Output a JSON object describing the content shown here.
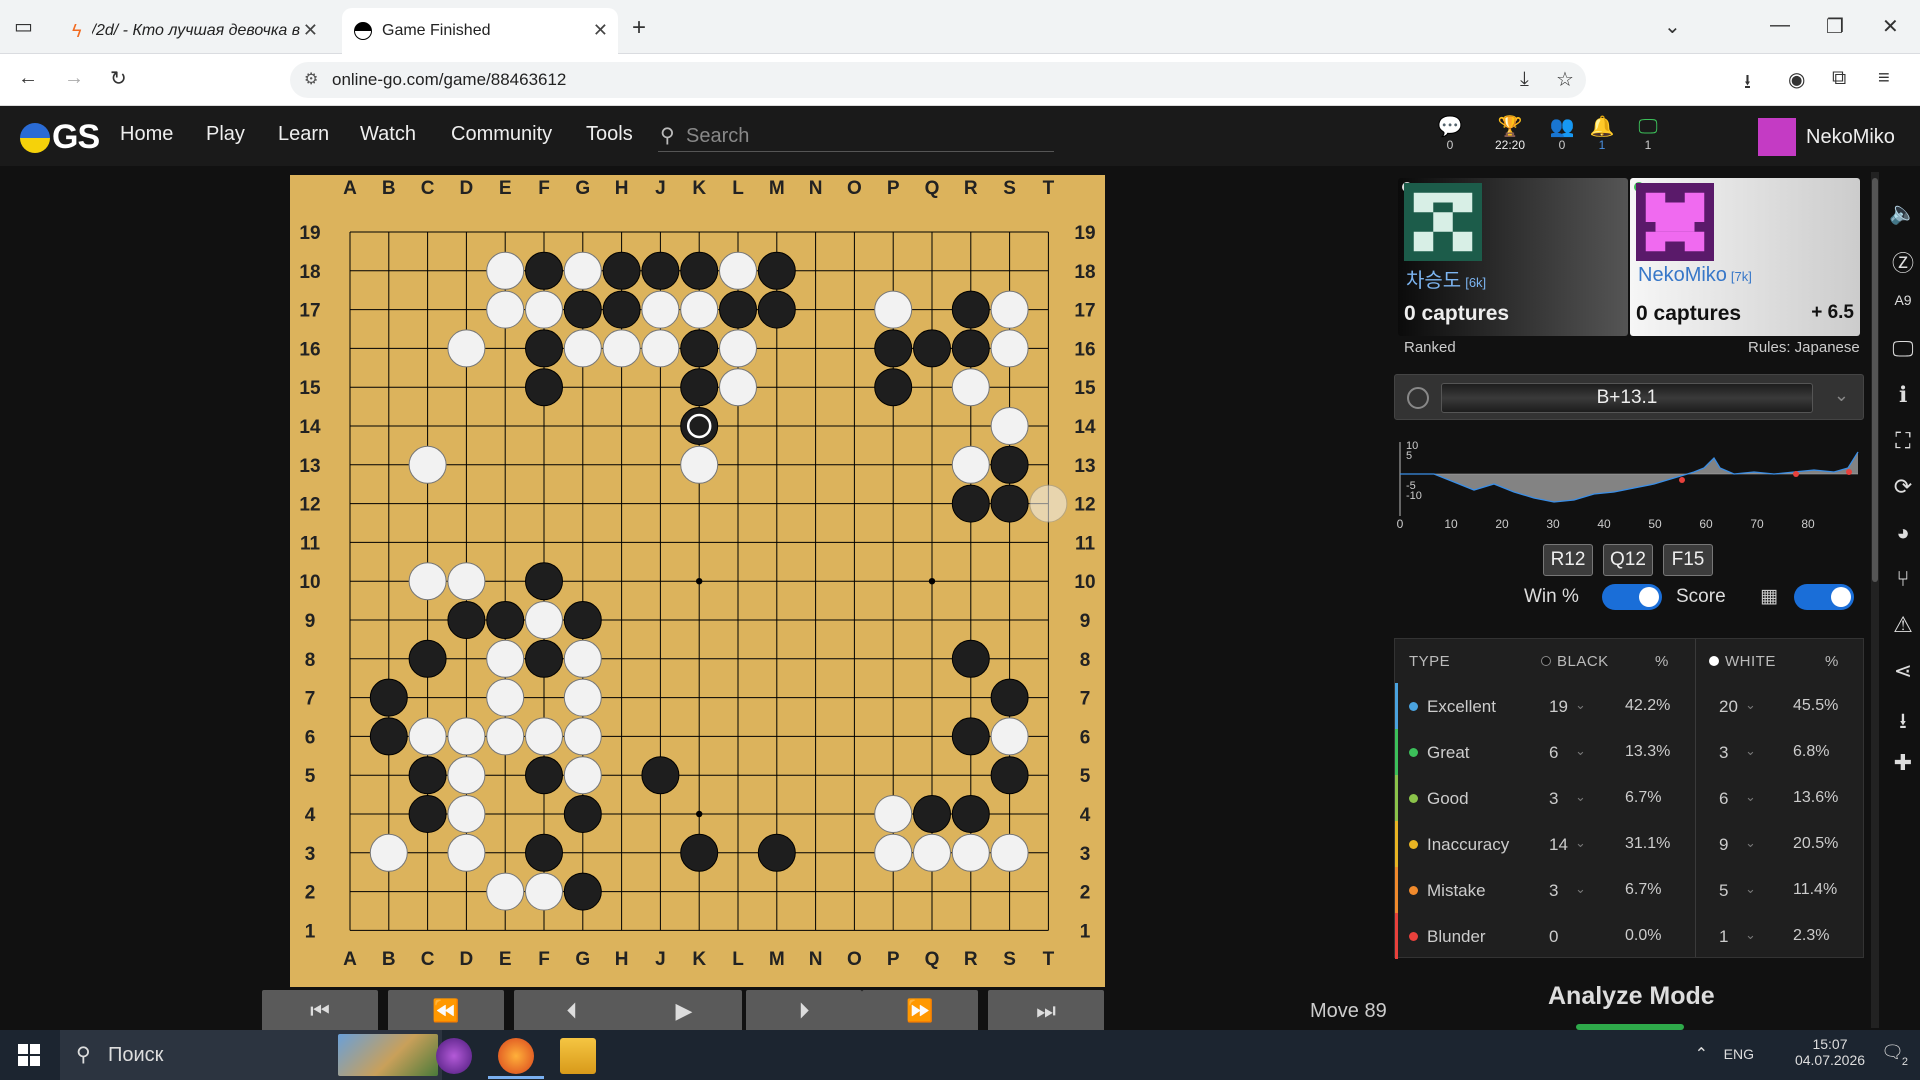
{
  "browser": {
    "tabs": [
      {
        "title": "/2d/ - Кто лучшая девочка в эт"
      },
      {
        "title": "Game Finished"
      }
    ],
    "url": "online-go.com/game/88463612"
  },
  "nav": {
    "logo": "GS",
    "links": [
      "Home",
      "Play",
      "Learn",
      "Watch",
      "Community",
      "Tools"
    ],
    "search_placeholder": "Search",
    "icons": [
      {
        "name": "chat-icon",
        "value": "0"
      },
      {
        "name": "trophy-icon",
        "value": "22:20"
      },
      {
        "name": "friends-icon",
        "value": "0"
      },
      {
        "name": "notifications-icon",
        "value": "1"
      },
      {
        "name": "games-icon",
        "value": "1"
      }
    ],
    "username": "NekoMiko"
  },
  "board": {
    "columns": [
      "A",
      "B",
      "C",
      "D",
      "E",
      "F",
      "G",
      "H",
      "J",
      "K",
      "L",
      "M",
      "N",
      "O",
      "P",
      "Q",
      "R",
      "S",
      "T"
    ],
    "rows": [
      "19",
      "18",
      "17",
      "16",
      "15",
      "14",
      "13",
      "12",
      "11",
      "10",
      "9",
      "8",
      "7",
      "6",
      "5",
      "4",
      "3",
      "2",
      "1"
    ],
    "grid": [
      "...................",
      "....wbwbbbwb.......",
      "....wwbbwwbb..w.bw.",
      "...w.bwwwbw...bbbw.",
      ".....b...bw...b.w..",
      ".........b.......w.",
      "..w......w......wb.",
      "................bb.",
      "...................",
      "..ww.b.............",
      "...bbwb............",
      "..b.wbw.........b..",
      ".b..w.w..........b.",
      ".bwwwww.........bw.",
      "..bw.bw.b........b.",
      "..bw..b.......wbb..",
      ".w.w.b...b.b..wwww.",
      "....wwb............",
      "..................."
    ],
    "last_move": "K14",
    "ghost_move": "T12"
  },
  "controls": {
    "buttons": [
      {
        "name": "first-move-button",
        "glyph": "⏮"
      },
      {
        "name": "back-ten-button",
        "glyph": "⏪"
      },
      {
        "name": "back-one-button",
        "glyph": "⏴"
      },
      {
        "name": "play-button",
        "glyph": "▶"
      },
      {
        "name": "forward-one-button",
        "glyph": "⏵"
      },
      {
        "name": "forward-ten-button",
        "glyph": "⏩"
      },
      {
        "name": "last-move-button",
        "glyph": "⏭"
      }
    ],
    "move_label": "Move 89"
  },
  "players": {
    "white": {
      "name": "차승도",
      "rank": "[6k]",
      "captures": "0 captures"
    },
    "black": {
      "name": "NekoMiko",
      "rank": "[7k]",
      "captures": "0 captures",
      "komi": "+ 6.5"
    },
    "ranked": "Ranked",
    "rules": "Rules: Japanese"
  },
  "result": "B+13.1",
  "graph": {
    "y_labels": [
      "10",
      "5",
      "-5",
      "-10"
    ],
    "x_labels": [
      "0",
      "10",
      "20",
      "30",
      "40",
      "50",
      "60",
      "70",
      "80"
    ]
  },
  "tags": [
    "R12",
    "Q12",
    "F15"
  ],
  "toggles": {
    "win_label": "Win %",
    "score_label": "Score"
  },
  "stats": {
    "headers": {
      "type": "TYPE",
      "black": "BLACK",
      "pct": "%",
      "white": "WHITE"
    },
    "rows": [
      {
        "label": "Excellent",
        "color": "#4aa3df",
        "black": "19",
        "black_pct": "42.2%",
        "white": "20",
        "white_pct": "45.5%"
      },
      {
        "label": "Great",
        "color": "#3cc05a",
        "black": "6",
        "black_pct": "13.3%",
        "white": "3",
        "white_pct": "6.8%"
      },
      {
        "label": "Good",
        "color": "#8bc34a",
        "black": "3",
        "black_pct": "6.7%",
        "white": "6",
        "white_pct": "13.6%"
      },
      {
        "label": "Inaccuracy",
        "color": "#e8b423",
        "black": "14",
        "black_pct": "31.1%",
        "white": "9",
        "white_pct": "20.5%"
      },
      {
        "label": "Mistake",
        "color": "#f08a2c",
        "black": "3",
        "black_pct": "6.7%",
        "white": "5",
        "white_pct": "11.4%"
      },
      {
        "label": "Blunder",
        "color": "#e8413c",
        "black": "0",
        "black_pct": "0.0%",
        "white": "1",
        "white_pct": "2.3%"
      }
    ]
  },
  "analyze": "Analyze Mode",
  "taskbar": {
    "search": "Поиск",
    "lang": "ENG",
    "time": "15:07",
    "date": "04.07.2026",
    "notif": "2"
  }
}
